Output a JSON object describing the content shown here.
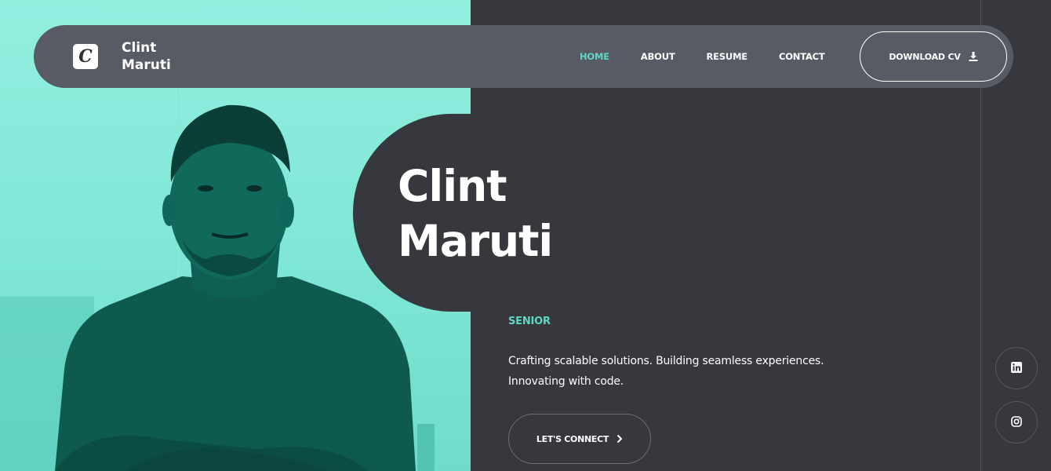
{
  "brand": {
    "logo_letter": "C",
    "name_line1": "Clint",
    "name_line2": "Maruti"
  },
  "nav": {
    "items": [
      {
        "label": "HOME",
        "active": true
      },
      {
        "label": "ABOUT",
        "active": false
      },
      {
        "label": "RESUME",
        "active": false
      },
      {
        "label": "CONTACT",
        "active": false
      }
    ],
    "cv_button": {
      "label": "DOWNLOAD CV",
      "icon": "download-icon"
    }
  },
  "hero": {
    "name_line1": "Clint",
    "name_line2": "Maruti",
    "role": "SENIOR",
    "tagline_line1": "Crafting scalable solutions. Building seamless experiences.",
    "tagline_line2": "Innovating with code.",
    "cta": {
      "label": "LET'S CONNECT",
      "icon": "chevron-right-icon"
    }
  },
  "social": [
    {
      "name": "linkedin",
      "icon": "linkedin-icon"
    },
    {
      "name": "instagram",
      "icon": "instagram-icon"
    }
  ],
  "colors": {
    "accent": "#5ed6c4",
    "background": "#36383d",
    "navbar": "#585b64",
    "photo_tint": "#8aeedf",
    "photo_shade": "#0f6a5c"
  }
}
